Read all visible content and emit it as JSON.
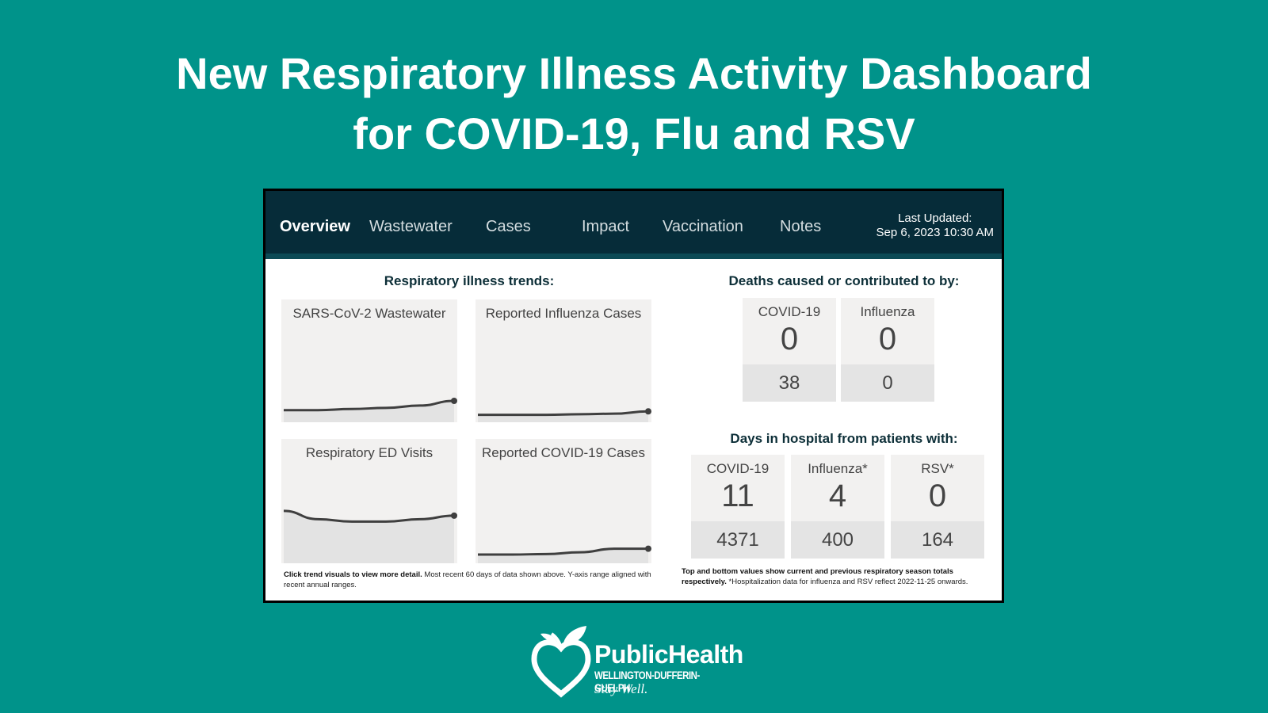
{
  "headline": {
    "line1": "New Respiratory Illness Activity Dashboard",
    "line2": "for COVID-19, Flu and RSV"
  },
  "nav": {
    "tabs": [
      {
        "label": "Overview",
        "active": true
      },
      {
        "label": "Wastewater",
        "active": false
      },
      {
        "label": "Cases",
        "active": false
      },
      {
        "label": "Impact",
        "active": false
      },
      {
        "label": "Vaccination",
        "active": false
      },
      {
        "label": "Notes",
        "active": false
      }
    ],
    "last_updated_label": "Last Updated:",
    "last_updated_value": "Sep 6, 2023 10:30 AM"
  },
  "trends": {
    "title": "Respiratory illness trends:",
    "cards": [
      {
        "title": "SARS-CoV-2 Wastewater",
        "trend": [
          0.09,
          0.09,
          0.1,
          0.11,
          0.13,
          0.17
        ]
      },
      {
        "title": "Reported Influenza Cases",
        "trend": [
          0.05,
          0.05,
          0.05,
          0.055,
          0.06,
          0.08
        ]
      },
      {
        "title": "Respiratory ED Visits",
        "trend": [
          0.43,
          0.36,
          0.34,
          0.34,
          0.36,
          0.39
        ]
      },
      {
        "title": "Reported COVID-19 Cases",
        "trend": [
          0.06,
          0.06,
          0.065,
          0.08,
          0.11,
          0.11
        ]
      }
    ],
    "note_bold": "Click trend visuals to view more detail.",
    "note_text": " Most recent 60 days of data shown above. Y-axis range aligned with recent annual ranges."
  },
  "deaths": {
    "title": "Deaths caused or contributed to by:",
    "cards": [
      {
        "label": "COVID-19",
        "current": "0",
        "previous": "38"
      },
      {
        "label": "Influenza",
        "current": "0",
        "previous": "0"
      }
    ]
  },
  "hospital": {
    "title": "Days in hospital from patients with:",
    "cards": [
      {
        "label": "COVID-19",
        "current": "11",
        "previous": "4371"
      },
      {
        "label": "Influenza*",
        "current": "4",
        "previous": "400"
      },
      {
        "label": "RSV*",
        "current": "0",
        "previous": "164"
      }
    ],
    "note_bold": "Top and bottom values show current and previous respiratory season totals respectively.",
    "note_text": " *Hospitalization data for influenza and RSV reflect 2022-11-25 onwards."
  },
  "logo": {
    "name": "PublicHealth",
    "region": "WELLINGTON-DUFFERIN-GUELPH",
    "tagline": "Stay Well."
  }
}
